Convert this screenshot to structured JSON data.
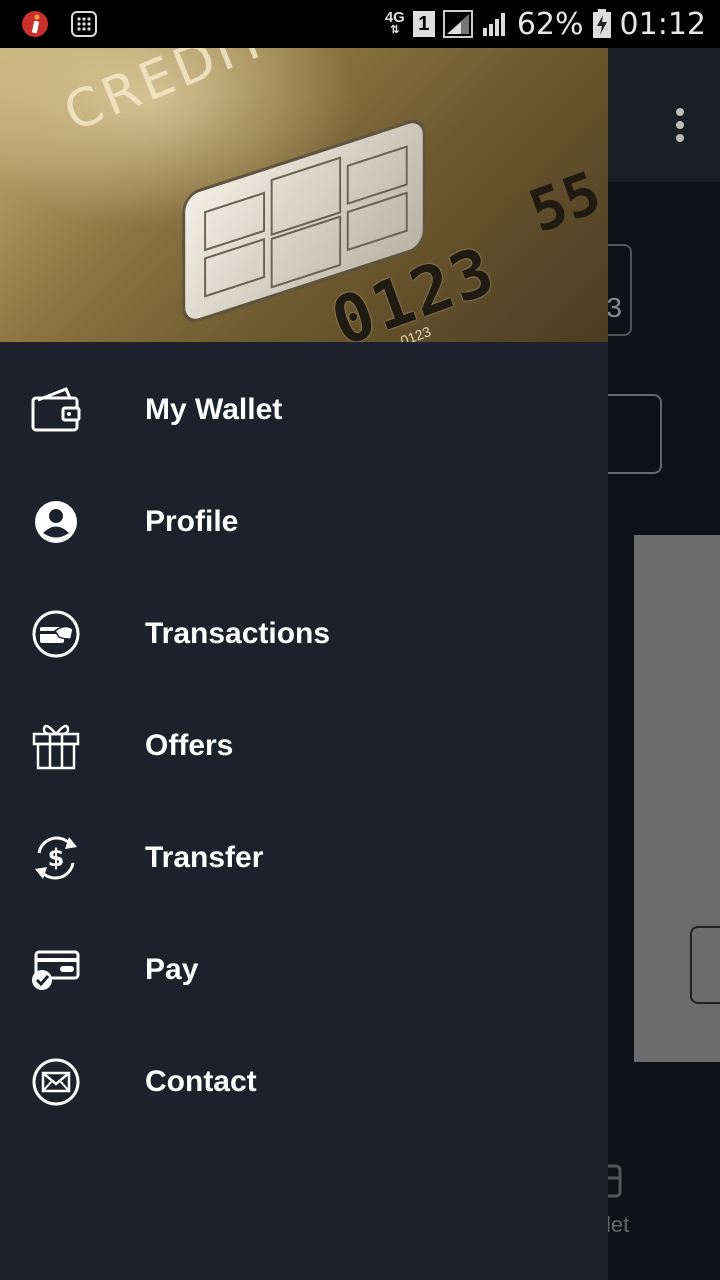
{
  "status_bar": {
    "network": "4G",
    "sim_slot": "1",
    "battery_percent": "62%",
    "time": "01:12"
  },
  "background": {
    "partial_value": "3",
    "bottom_nav_partial_label": "let"
  },
  "drawer": {
    "header": {
      "card_text": "CREDIT CA",
      "card_number_main": "0123",
      "card_number_partial": "55",
      "card_small_number": "0123"
    },
    "menu": [
      {
        "label": "My Wallet",
        "icon": "wallet-icon"
      },
      {
        "label": "Profile",
        "icon": "profile-icon"
      },
      {
        "label": "Transactions",
        "icon": "transactions-icon"
      },
      {
        "label": "Offers",
        "icon": "gift-icon"
      },
      {
        "label": "Transfer",
        "icon": "transfer-icon"
      },
      {
        "label": "Pay",
        "icon": "pay-icon"
      },
      {
        "label": "Contact",
        "icon": "mail-icon"
      }
    ]
  },
  "colors": {
    "drawer_bg": "#1c212b",
    "text": "#ffffff",
    "status_bar": "#000000"
  }
}
